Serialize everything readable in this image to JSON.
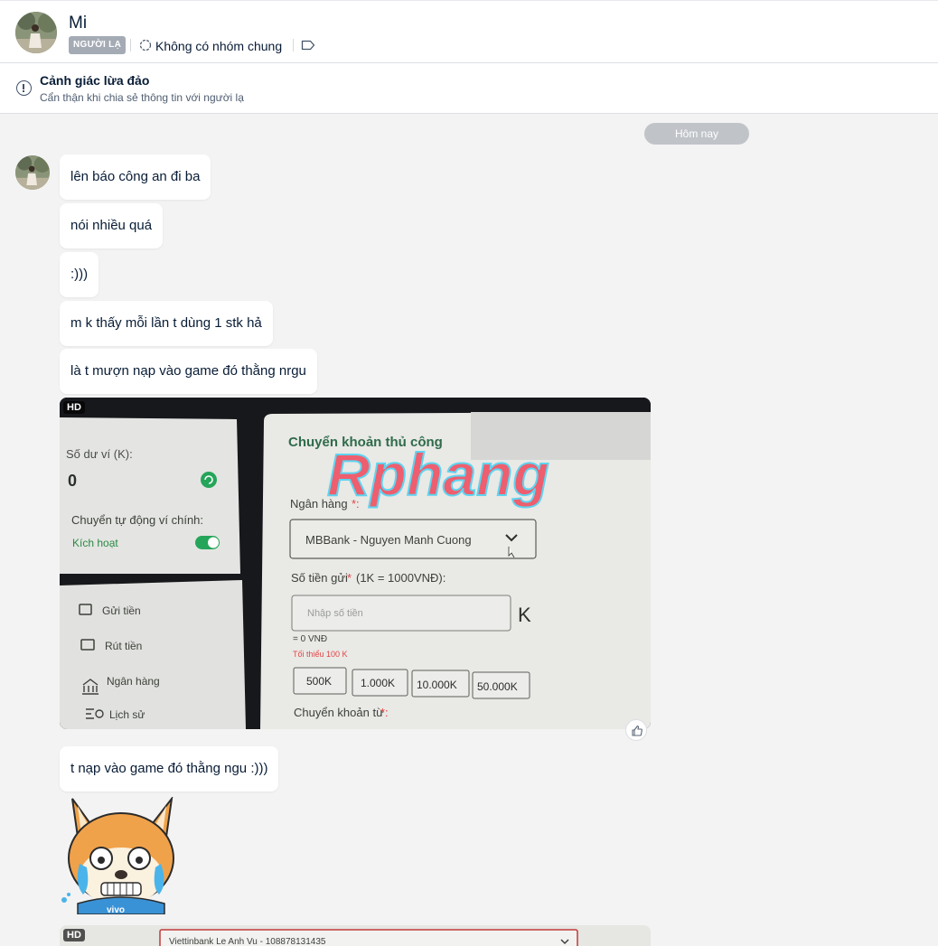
{
  "header": {
    "name": "Mi",
    "stranger_badge": "NGƯỜI LẠ",
    "common_groups": "Không có nhóm chung"
  },
  "warning": {
    "title": "Cảnh giác lừa đảo",
    "subtitle": "Cẩn thận khi chia sẻ thông tin với người lạ"
  },
  "chat": {
    "date_divider": "Hôm nay",
    "messages": [
      "lên báo công an đi ba",
      "nói nhiều quá",
      ":)))",
      "m k thấy mỗi lần t dùng 1 stk hả",
      "là t mượn nạp vào game đó thằng nrgu",
      "t nạp vào game đó thằng ngu :)))"
    ],
    "photo_badge": "HD"
  },
  "photo1": {
    "balance_label": "Số dư ví (K):",
    "balance_value": "0",
    "auto_transfer_label": "Chuyển tự động ví chính:",
    "activate_label": "Kích hoạt",
    "menu": [
      "Gửi tiền",
      "Rút tiền",
      "Ngân hàng",
      "Lịch sử"
    ],
    "panel_title": "Chuyển khoản thủ công",
    "watermark": "Rphang",
    "bank_label": "Ngân hàng",
    "bank_value": "MBBank - Nguyen Manh Cuong",
    "amount_label": "Số tiền gửi",
    "amount_rate": "(1K = 1000VNĐ):",
    "amount_placeholder": "Nhập số tiền",
    "amount_unit": "K",
    "converted": "= 0 VNĐ",
    "minimum": "Tối thiểu 100 K",
    "quick_amounts": [
      "500K",
      "1.000K",
      "10.000K",
      "50.000K"
    ],
    "transfer_from": "Chuyển khoản từ"
  },
  "photo2": {
    "badge": "HD",
    "text": "Viettinbank Le Anh Vu - 108878131435"
  },
  "sticker": {
    "shirt_text": "vivo"
  }
}
